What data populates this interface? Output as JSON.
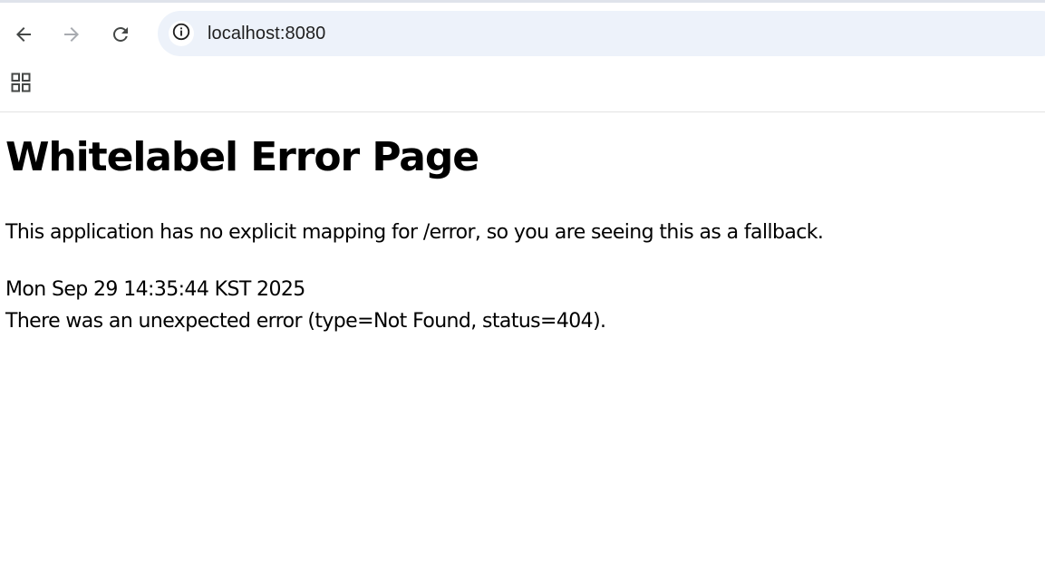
{
  "browser": {
    "url": "localhost:8080",
    "icons": {
      "back": "arrow-left-icon",
      "forward": "arrow-right-icon",
      "reload": "reload-icon",
      "site_info": "info-icon",
      "apps": "apps-grid-icon"
    },
    "colors": {
      "omnibox_bg": "#edf2fa",
      "icon_active": "#444746",
      "icon_disabled": "#a8abb0"
    }
  },
  "page": {
    "title": "Whitelabel Error Page",
    "description": "This application has no explicit mapping for /error, so you are seeing this as a fallback.",
    "timestamp": "Mon Sep 29 14:35:44 KST 2025",
    "error_message": "There was an unexpected error (type=Not Found, status=404)."
  }
}
